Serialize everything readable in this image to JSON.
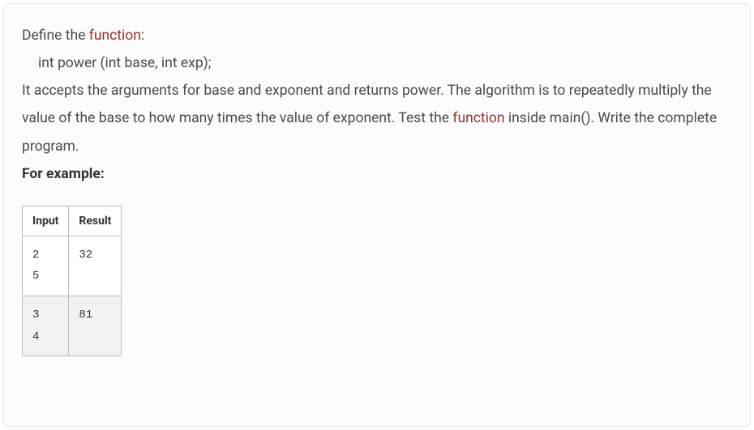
{
  "intro": {
    "define_prefix": "Define the ",
    "function_word": "function",
    "colon": ":",
    "signature": "int power (int base, int exp);",
    "desc_part1": "It accepts the arguments for base and exponent and returns power. The algorithm is to repeatedly multiply the value of the base to how many times the value of exponent. Test the ",
    "desc_part2": " inside main(). Write the complete program.",
    "example_label": "For example:"
  },
  "table": {
    "headers": {
      "input": "Input",
      "result": "Result"
    },
    "rows": [
      {
        "input": "2\n5",
        "result": "32"
      },
      {
        "input": "3\n4",
        "result": "81"
      }
    ]
  }
}
